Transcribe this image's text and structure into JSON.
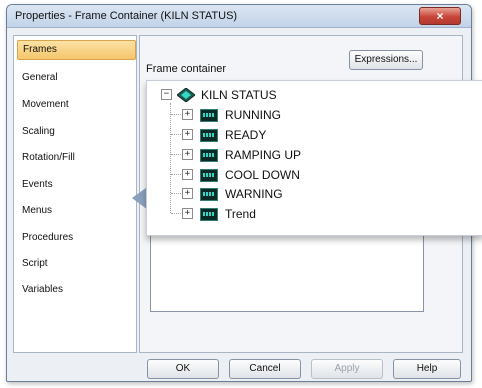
{
  "window": {
    "title": "Properties - Frame Container (KILN STATUS)",
    "close_glyph": "×"
  },
  "sidebar": {
    "items": [
      {
        "label": "Frames",
        "active": true
      },
      {
        "label": "General"
      },
      {
        "label": "Movement"
      },
      {
        "label": "Scaling"
      },
      {
        "label": "Rotation/Fill"
      },
      {
        "label": "Events"
      },
      {
        "label": "Menus"
      },
      {
        "label": "Procedures"
      },
      {
        "label": "Script"
      },
      {
        "label": "Variables"
      }
    ]
  },
  "main": {
    "expressions_label": "Expressions...",
    "frame_container_label": "Frame container",
    "tree": {
      "root": {
        "label": "KILN STATUS",
        "expander": "−",
        "icon": "container-icon"
      },
      "children": [
        {
          "label": "RUNNING",
          "expander": "+",
          "icon": "frame-icon"
        },
        {
          "label": "READY",
          "expander": "+",
          "icon": "frame-icon"
        },
        {
          "label": "RAMPING UP",
          "expander": "+",
          "icon": "frame-icon"
        },
        {
          "label": "COOL DOWN",
          "expander": "+",
          "icon": "frame-icon"
        },
        {
          "label": "WARNING",
          "expander": "+",
          "icon": "frame-icon"
        },
        {
          "label": "Trend",
          "expander": "+",
          "icon": "frame-icon"
        }
      ]
    }
  },
  "footer": {
    "ok_label": "OK",
    "cancel_label": "Cancel",
    "apply_label": "Apply",
    "help_label": "Help"
  },
  "colors": {
    "active_tab": "#f5c66b",
    "close_button": "#c8453a",
    "frame_icon": "#35d6c3"
  }
}
